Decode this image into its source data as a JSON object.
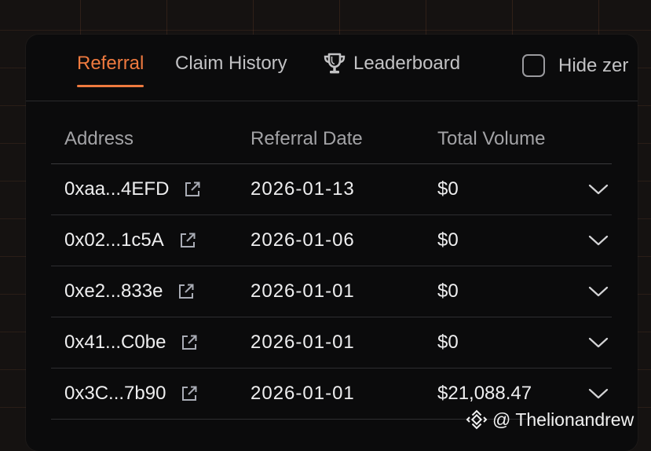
{
  "tabs": [
    {
      "label": "Referral",
      "active": true
    },
    {
      "label": "Claim History",
      "active": false
    },
    {
      "label": "Leaderboard",
      "active": false
    }
  ],
  "hide_zero": {
    "label": "Hide zer",
    "checked": false
  },
  "table": {
    "headers": [
      "Address",
      "Referral Date",
      "Total Volume"
    ],
    "rows": [
      {
        "address": "0xaa...4EFD",
        "date": "2026-01-13",
        "volume": "$0"
      },
      {
        "address": "0x02...1c5A",
        "date": "2026-01-06",
        "volume": "$0"
      },
      {
        "address": "0xe2...833e",
        "date": "2026-01-01",
        "volume": "$0"
      },
      {
        "address": "0x41...C0be",
        "date": "2026-01-01",
        "volume": "$0"
      },
      {
        "address": "0x3C...7b90",
        "date": "2026-01-01",
        "volume": "$21,088.47"
      }
    ]
  },
  "watermark": {
    "text": "@ Thelionandrew"
  },
  "colors": {
    "accent": "#ef7a3f",
    "panel": "#0b0b0c",
    "background": "#151211"
  },
  "icons": {
    "leaderboard": "trophy-icon",
    "address_link": "external-link-icon",
    "row_expand": "chevron-down-icon",
    "watermark": "binance-logo-icon"
  }
}
